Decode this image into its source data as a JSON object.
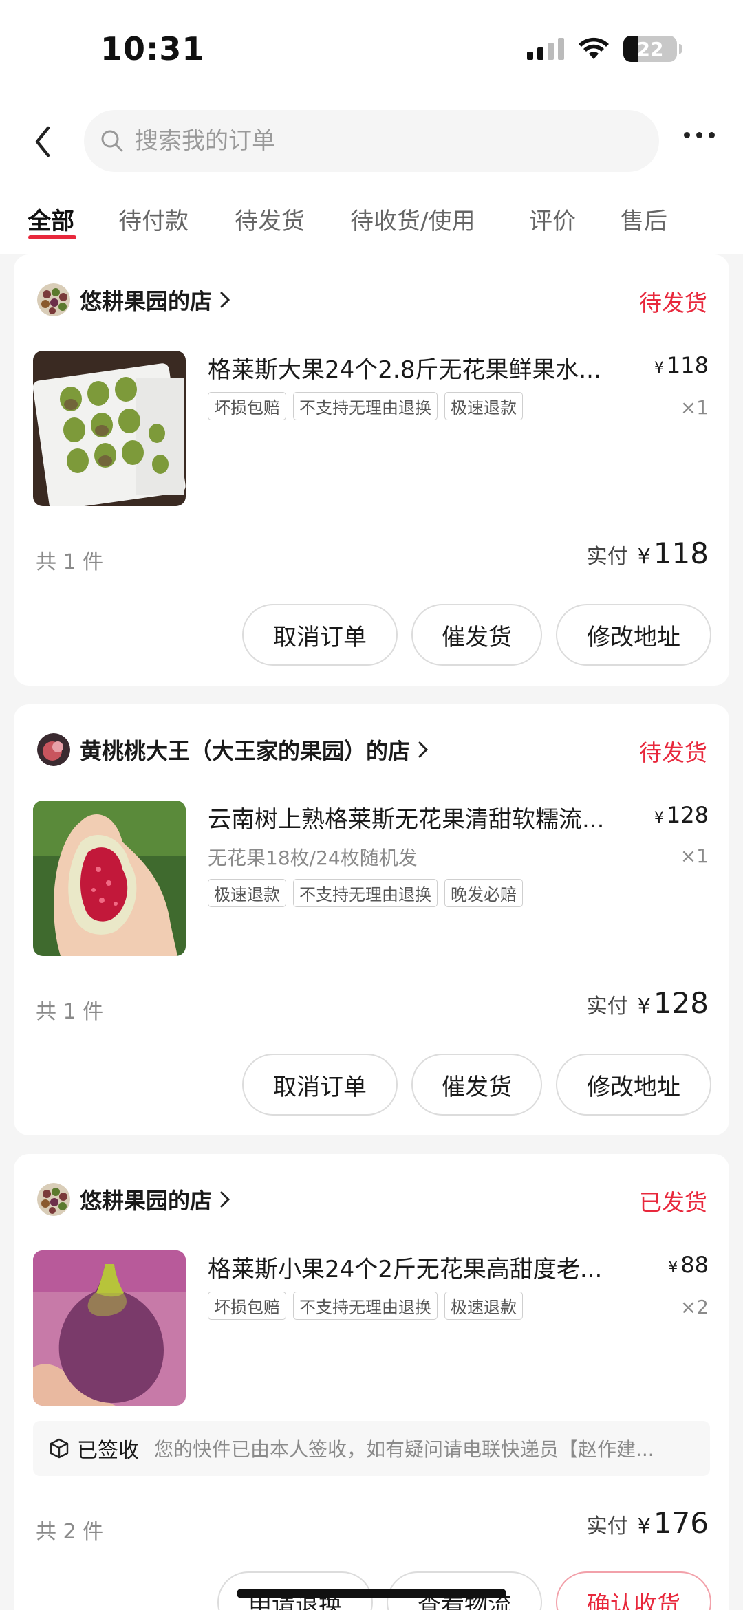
{
  "status_bar": {
    "time": "10:31",
    "battery": "22"
  },
  "search": {
    "placeholder": "搜索我的订单"
  },
  "tabs": [
    {
      "label": "全部",
      "active": true
    },
    {
      "label": "待付款"
    },
    {
      "label": "待发货"
    },
    {
      "label": "待收货/使用"
    },
    {
      "label": "评价"
    },
    {
      "label": "售后"
    }
  ],
  "orders": [
    {
      "shop": "悠耕果园的店",
      "status": "待发货",
      "title": "格莱斯大果24个2.8斤无花果鲜果水...",
      "price_symbol": "¥",
      "price": "118",
      "qty": "×1",
      "tags": [
        "坏损包赔",
        "不支持无理由退换",
        "极速退款"
      ],
      "count": "共 1 件",
      "total_label": "实付",
      "total_symbol": "¥",
      "total": "118",
      "buttons": [
        "取消订单",
        "催发货",
        "修改地址"
      ]
    },
    {
      "shop": "黄桃桃大王（大王家的果园）的店",
      "status": "待发货",
      "title": "云南树上熟格莱斯无花果清甜软糯流...",
      "variant": "无花果18枚/24枚随机发",
      "price_symbol": "¥",
      "price": "128",
      "qty": "×1",
      "tags": [
        "极速退款",
        "不支持无理由退换",
        "晚发必赔"
      ],
      "count": "共 1 件",
      "total_label": "实付",
      "total_symbol": "¥",
      "total": "128",
      "buttons": [
        "取消订单",
        "催发货",
        "修改地址"
      ]
    },
    {
      "shop": "悠耕果园的店",
      "status": "已发货",
      "title": "格莱斯小果24个2斤无花果高甜度老...",
      "price_symbol": "¥",
      "price": "88",
      "qty": "×2",
      "tags": [
        "坏损包赔",
        "不支持无理由退换",
        "极速退款"
      ],
      "logistics_status": "已签收",
      "logistics_detail": "您的快件已由本人签收，如有疑问请电联快递员【赵作建...",
      "count": "共 2 件",
      "total_label": "实付",
      "total_symbol": "¥",
      "total": "176",
      "buttons": [
        "申请退换",
        "查看物流",
        "确认收货"
      ]
    }
  ],
  "colors": {
    "accent": "#e8283c",
    "background": "#f5f5f5",
    "card": "#ffffff"
  }
}
